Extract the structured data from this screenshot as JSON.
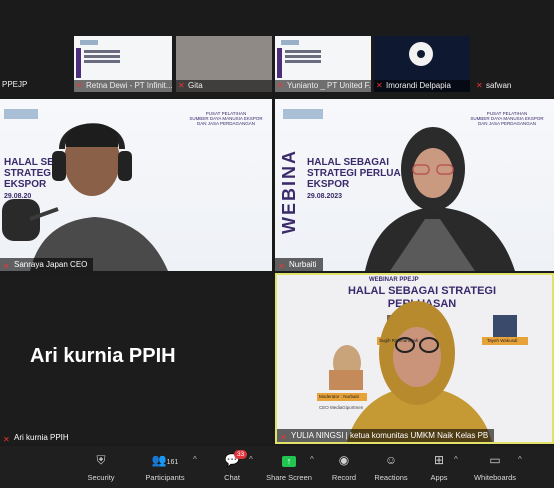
{
  "top_strip": {
    "left_label": "PPEJP",
    "thumbs": [
      {
        "name": "Retna Dewi - PT Infinit..."
      },
      {
        "name": "Gita"
      },
      {
        "name": "Yunianto _ PT United F..."
      },
      {
        "name": "Imorandi Delpapia"
      },
      {
        "name": "safwan"
      }
    ]
  },
  "tiles": {
    "top_left": {
      "name": "Sanraya Japan CEO",
      "slide_title": "HALAL SE\nSTRATEG\nEKSPOR",
      "slide_date": "29.08.20",
      "slide_sub": "PUSAT PELATIHAN\nSUMBER DAYA MANUSIA EKSPOR\nDAN JASA PERDAGANGAN"
    },
    "top_right": {
      "name": "Nurbaiti",
      "vertical": "WEBINA",
      "slide_title": "HALAL SEBAGAI\nSTRATEGI PERLUASAN\nEKSPOR",
      "slide_date": "29.08.2023",
      "slide_sub": "PUSAT PELATIHAN\nSUMBER DAYA MANUSIA EKSPOR\nDAN JASA PERDAGANGAN"
    },
    "bottom_left": {
      "big_name": "Ari kurnia PPIH",
      "name": "Ari kurnia PPIH"
    },
    "bottom_right": {
      "name": "YULIA NINGSI | ketua komunitas UMKM Naik Kelas PB",
      "banner_top": "WEBINAR PPEJP",
      "banner_title": "HALAL SEBAGAI STRATEGI\nPERLUASAN",
      "speaker1": "Sugih Rahmansyah",
      "speaker2": "Tayeh Wakusdi",
      "moderator": "Moderator : Nurbaiti",
      "moderator_role": "CEO MediaGiportmen"
    }
  },
  "toolbar": {
    "security": "Security",
    "participants": "Participants",
    "participants_count": "161",
    "chat": "Chat",
    "chat_badge": "33",
    "share": "Share Screen",
    "record": "Record",
    "reactions": "Reactions",
    "apps": "Apps",
    "whiteboards": "Whiteboards"
  },
  "colors": {
    "active_speaker_border": "#e2e26b",
    "share_green": "#23c552",
    "slide_purple": "#3b2a6b"
  }
}
